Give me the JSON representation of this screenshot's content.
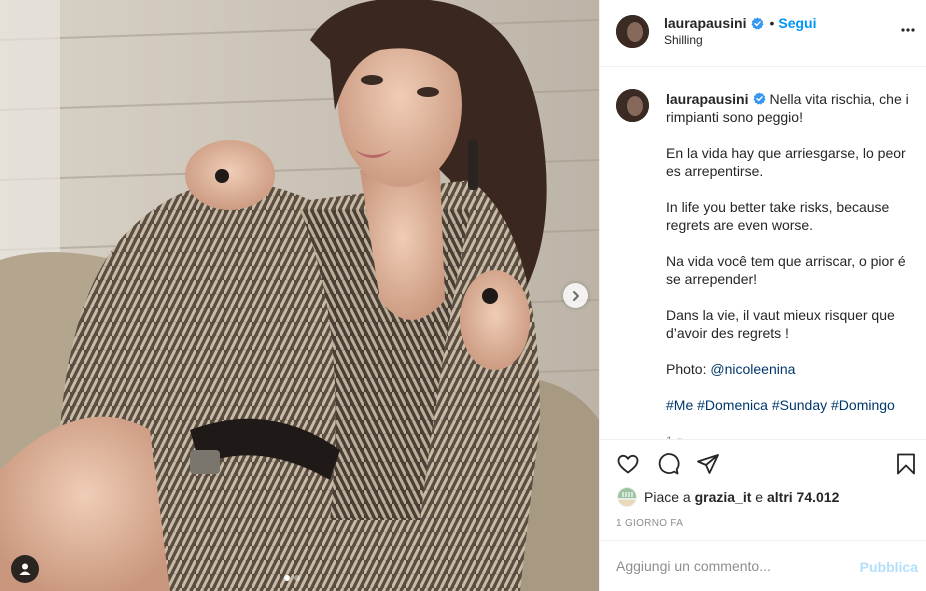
{
  "post": {
    "username": "laurapausini",
    "follow_label": "Segui",
    "separator": "•",
    "location": "Shilling",
    "more_icon": "more-horizontal-icon",
    "verified_icon": "verified-badge-icon",
    "colors": {
      "accent": "#0095f6",
      "verified": "#3897f0",
      "link": "#00376b",
      "muted": "#8e8e8e",
      "publish_disabled": "#b2dffc"
    }
  },
  "caption": {
    "username": "laurapausini",
    "line_it": "Nella vita rischia, che i rimpianti sono peggio!",
    "line_es": "En la vida hay que arriesgarse, lo peor es arrepentirse.",
    "line_en": "In life you better take risks, because regrets are even worse.",
    "line_pt": "Na vida você tem que arriscar, o pior é se arrepender!",
    "line_fr": "Dans la vie, il vaut mieux risquer que d’avoir des regrets !",
    "photo_prefix": "Photo:",
    "photo_credit": "@nicoleenina",
    "hashtags": [
      "#Me",
      "#Domenica",
      "#Sunday",
      "#Domingo"
    ],
    "time_ago": "1 g"
  },
  "actions": {
    "like_icon": "heart-icon",
    "comment_icon": "comment-icon",
    "share_icon": "send-icon",
    "save_icon": "bookmark-icon"
  },
  "likes": {
    "prefix": "Piace a",
    "liker": "grazia_it",
    "conjunction": "e",
    "others": "altri 74.012"
  },
  "timestamp": "1 GIORNO FA",
  "comment": {
    "placeholder": "Aggiungi un commento...",
    "publish_label": "Pubblica"
  },
  "carousel": {
    "next_icon": "chevron-right-icon",
    "tag_icon": "user-tag-icon",
    "slides_count": 2,
    "active_index": 0
  }
}
